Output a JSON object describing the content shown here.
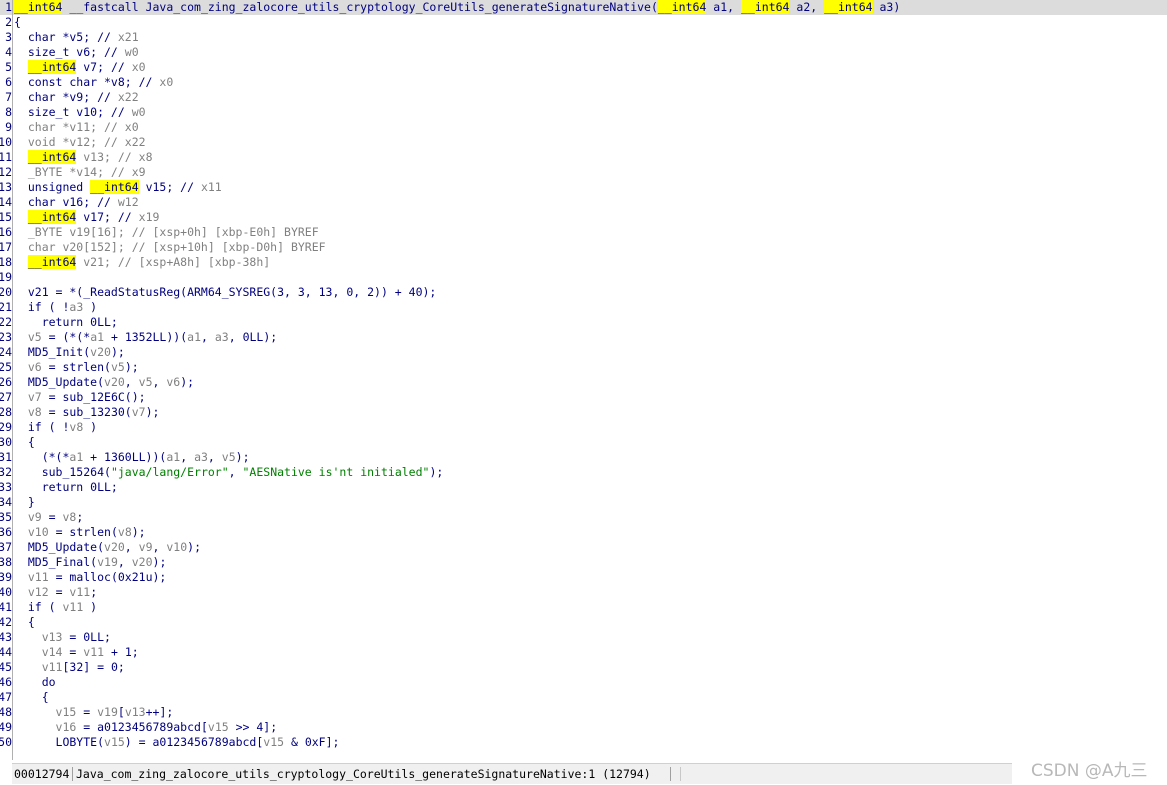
{
  "code_lines": [
    {
      "no": "1",
      "tokens": [
        [
          "__int64",
          "h"
        ],
        [
          " __fastcall Java_com_zing_zalocore_utils_cryptology_CoreUtils_generateSignatureNative(",
          ""
        ],
        [
          "__int64",
          "h"
        ],
        [
          " a1, ",
          ""
        ],
        [
          "__int64",
          "h"
        ],
        [
          " a2, ",
          ""
        ],
        [
          "__int64",
          "h"
        ],
        [
          " a3)",
          ""
        ]
      ]
    },
    {
      "no": "2",
      "tokens": [
        [
          "{",
          ""
        ]
      ]
    },
    {
      "no": "3",
      "tokens": [
        [
          "  char *v5; // ",
          ""
        ],
        [
          "x21",
          "g"
        ]
      ]
    },
    {
      "no": "4",
      "tokens": [
        [
          "  size_t v6; // ",
          ""
        ],
        [
          "w0",
          "g"
        ]
      ]
    },
    {
      "no": "5",
      "tokens": [
        [
          "  ",
          ""
        ],
        [
          "__int64",
          "h"
        ],
        [
          " v7; // ",
          ""
        ],
        [
          "x0",
          "g"
        ]
      ]
    },
    {
      "no": "6",
      "tokens": [
        [
          "  const char *v8; // ",
          ""
        ],
        [
          "x0",
          "g"
        ]
      ]
    },
    {
      "no": "7",
      "tokens": [
        [
          "  char *v9; // ",
          ""
        ],
        [
          "x22",
          "g"
        ]
      ]
    },
    {
      "no": "8",
      "tokens": [
        [
          "  size_t v10; // ",
          ""
        ],
        [
          "w0",
          "g"
        ]
      ]
    },
    {
      "no": "9",
      "tokens": [
        [
          "  char *v11; // x0",
          "g"
        ]
      ]
    },
    {
      "no": "10",
      "tokens": [
        [
          "  void *v12; // x22",
          "g"
        ]
      ]
    },
    {
      "no": "11",
      "tokens": [
        [
          "  ",
          ""
        ],
        [
          "__int64",
          "h"
        ],
        [
          " v13; // x8",
          "g"
        ]
      ]
    },
    {
      "no": "12",
      "tokens": [
        [
          "  _BYTE *v14; // x9",
          "g"
        ]
      ]
    },
    {
      "no": "13",
      "tokens": [
        [
          "  unsigned ",
          ""
        ],
        [
          "__int64",
          "h"
        ],
        [
          " v15; // ",
          ""
        ],
        [
          "x11",
          "g"
        ]
      ]
    },
    {
      "no": "14",
      "tokens": [
        [
          "  char v16; // ",
          ""
        ],
        [
          "w12",
          "g"
        ]
      ]
    },
    {
      "no": "15",
      "tokens": [
        [
          "  ",
          ""
        ],
        [
          "__int64",
          "h"
        ],
        [
          " v17; // ",
          ""
        ],
        [
          "x19",
          "g"
        ]
      ]
    },
    {
      "no": "16",
      "tokens": [
        [
          "  _BYTE v19[16]; // [xsp+0h] [xbp-E0h] BYREF",
          "g"
        ]
      ]
    },
    {
      "no": "17",
      "tokens": [
        [
          "  char v20[152]; // [xsp+10h] [xbp-D0h] BYREF",
          "g"
        ]
      ]
    },
    {
      "no": "18",
      "tokens": [
        [
          "  ",
          ""
        ],
        [
          "__int64",
          "h"
        ],
        [
          " v21; // [xsp+A8h] [xbp-38h]",
          "g"
        ]
      ]
    },
    {
      "no": "19",
      "tokens": [
        [
          "",
          ""
        ]
      ]
    },
    {
      "no": "20",
      "tokens": [
        [
          "  v21 = *(_ReadStatusReg(ARM64_SYSREG(3, 3, 13, 0, 2)) + 40);",
          ""
        ]
      ]
    },
    {
      "no": "21",
      "tokens": [
        [
          "  if ( !",
          ""
        ],
        [
          "a3",
          "g"
        ],
        [
          " )",
          ""
        ]
      ]
    },
    {
      "no": "22",
      "tokens": [
        [
          "    return 0LL;",
          ""
        ]
      ]
    },
    {
      "no": "23",
      "tokens": [
        [
          "  ",
          ""
        ],
        [
          "v5",
          "g"
        ],
        [
          " = (*(*",
          ""
        ],
        [
          "a1",
          "g"
        ],
        [
          " + 1352LL))(",
          ""
        ],
        [
          "a1",
          "g"
        ],
        [
          ", ",
          ""
        ],
        [
          "a3",
          "g"
        ],
        [
          ", 0LL);",
          ""
        ]
      ]
    },
    {
      "no": "24",
      "tokens": [
        [
          "  MD5_Init(",
          ""
        ],
        [
          "v20",
          "g"
        ],
        [
          ");",
          ""
        ]
      ]
    },
    {
      "no": "25",
      "tokens": [
        [
          "  ",
          ""
        ],
        [
          "v6",
          "g"
        ],
        [
          " = strlen(",
          ""
        ],
        [
          "v5",
          "g"
        ],
        [
          ");",
          ""
        ]
      ]
    },
    {
      "no": "26",
      "tokens": [
        [
          "  MD5_Update(",
          ""
        ],
        [
          "v20",
          "g"
        ],
        [
          ", ",
          ""
        ],
        [
          "v5",
          "g"
        ],
        [
          ", ",
          ""
        ],
        [
          "v6",
          "g"
        ],
        [
          ");",
          ""
        ]
      ]
    },
    {
      "no": "27",
      "tokens": [
        [
          "  ",
          ""
        ],
        [
          "v7",
          "g"
        ],
        [
          " = sub_12E6C();",
          ""
        ]
      ]
    },
    {
      "no": "28",
      "tokens": [
        [
          "  ",
          ""
        ],
        [
          "v8",
          "g"
        ],
        [
          " = sub_13230(",
          ""
        ],
        [
          "v7",
          "g"
        ],
        [
          ");",
          ""
        ]
      ]
    },
    {
      "no": "29",
      "tokens": [
        [
          "  if ( !",
          ""
        ],
        [
          "v8",
          "g"
        ],
        [
          " )",
          ""
        ]
      ]
    },
    {
      "no": "30",
      "tokens": [
        [
          "  {",
          ""
        ]
      ]
    },
    {
      "no": "31",
      "tokens": [
        [
          "    (*(*",
          ""
        ],
        [
          "a1",
          "g"
        ],
        [
          " + 1360LL))(",
          ""
        ],
        [
          "a1",
          "g"
        ],
        [
          ", ",
          ""
        ],
        [
          "a3",
          "g"
        ],
        [
          ", ",
          ""
        ],
        [
          "v5",
          "g"
        ],
        [
          ");",
          ""
        ]
      ]
    },
    {
      "no": "32",
      "tokens": [
        [
          "    sub_15264(",
          ""
        ],
        [
          "\"java/lang/Error\"",
          "s"
        ],
        [
          ", ",
          ""
        ],
        [
          "\"AESNative is'nt initialed\"",
          "s"
        ],
        [
          ");",
          ""
        ]
      ]
    },
    {
      "no": "33",
      "tokens": [
        [
          "    return 0LL;",
          ""
        ]
      ]
    },
    {
      "no": "34",
      "tokens": [
        [
          "  }",
          ""
        ]
      ]
    },
    {
      "no": "35",
      "tokens": [
        [
          "  ",
          ""
        ],
        [
          "v9",
          "g"
        ],
        [
          " = ",
          ""
        ],
        [
          "v8",
          "g"
        ],
        [
          ";",
          ""
        ]
      ]
    },
    {
      "no": "36",
      "tokens": [
        [
          "  ",
          ""
        ],
        [
          "v10",
          "g"
        ],
        [
          " = strlen(",
          ""
        ],
        [
          "v8",
          "g"
        ],
        [
          ");",
          ""
        ]
      ]
    },
    {
      "no": "37",
      "tokens": [
        [
          "  MD5_Update(",
          ""
        ],
        [
          "v20",
          "g"
        ],
        [
          ", ",
          ""
        ],
        [
          "v9",
          "g"
        ],
        [
          ", ",
          ""
        ],
        [
          "v10",
          "g"
        ],
        [
          ");",
          ""
        ]
      ]
    },
    {
      "no": "38",
      "tokens": [
        [
          "  MD5_Final(",
          ""
        ],
        [
          "v19",
          "g"
        ],
        [
          ", ",
          ""
        ],
        [
          "v20",
          "g"
        ],
        [
          ");",
          ""
        ]
      ]
    },
    {
      "no": "39",
      "tokens": [
        [
          "  ",
          ""
        ],
        [
          "v11",
          "g"
        ],
        [
          " = malloc(0x21u);",
          ""
        ]
      ]
    },
    {
      "no": "40",
      "tokens": [
        [
          "  ",
          ""
        ],
        [
          "v12",
          "g"
        ],
        [
          " = ",
          ""
        ],
        [
          "v11",
          "g"
        ],
        [
          ";",
          ""
        ]
      ]
    },
    {
      "no": "41",
      "tokens": [
        [
          "  if ( ",
          ""
        ],
        [
          "v11",
          "g"
        ],
        [
          " )",
          ""
        ]
      ]
    },
    {
      "no": "42",
      "tokens": [
        [
          "  {",
          ""
        ]
      ]
    },
    {
      "no": "43",
      "tokens": [
        [
          "    ",
          ""
        ],
        [
          "v13",
          "g"
        ],
        [
          " = 0LL;",
          ""
        ]
      ]
    },
    {
      "no": "44",
      "tokens": [
        [
          "    ",
          ""
        ],
        [
          "v14",
          "g"
        ],
        [
          " = ",
          ""
        ],
        [
          "v11",
          "g"
        ],
        [
          " + 1;",
          ""
        ]
      ]
    },
    {
      "no": "45",
      "tokens": [
        [
          "    ",
          ""
        ],
        [
          "v11",
          "g"
        ],
        [
          "[32] = 0;",
          ""
        ]
      ]
    },
    {
      "no": "46",
      "tokens": [
        [
          "    do",
          ""
        ]
      ]
    },
    {
      "no": "47",
      "tokens": [
        [
          "    {",
          ""
        ]
      ]
    },
    {
      "no": "48",
      "tokens": [
        [
          "      ",
          ""
        ],
        [
          "v15",
          "g"
        ],
        [
          " = ",
          ""
        ],
        [
          "v19",
          "g"
        ],
        [
          "[",
          ""
        ],
        [
          "v13",
          "g"
        ],
        [
          "++];",
          ""
        ]
      ]
    },
    {
      "no": "49",
      "tokens": [
        [
          "      ",
          ""
        ],
        [
          "v16",
          "g"
        ],
        [
          " = a0123456789abcd[",
          ""
        ],
        [
          "v15",
          "g"
        ],
        [
          " >> 4];",
          ""
        ]
      ]
    },
    {
      "no": "50",
      "tokens": [
        [
          "      LOBYTE(",
          ""
        ],
        [
          "v15",
          "g"
        ],
        [
          ") = a0123456789abcd[",
          ""
        ],
        [
          "v15",
          "g"
        ],
        [
          " & 0xF];",
          ""
        ]
      ]
    }
  ],
  "status": {
    "address": "00012794",
    "location": "Java_com_zing_zalocore_utils_cryptology_CoreUtils_generateSignatureNative:1 (12794)"
  },
  "watermark": "CSDN @A九三"
}
